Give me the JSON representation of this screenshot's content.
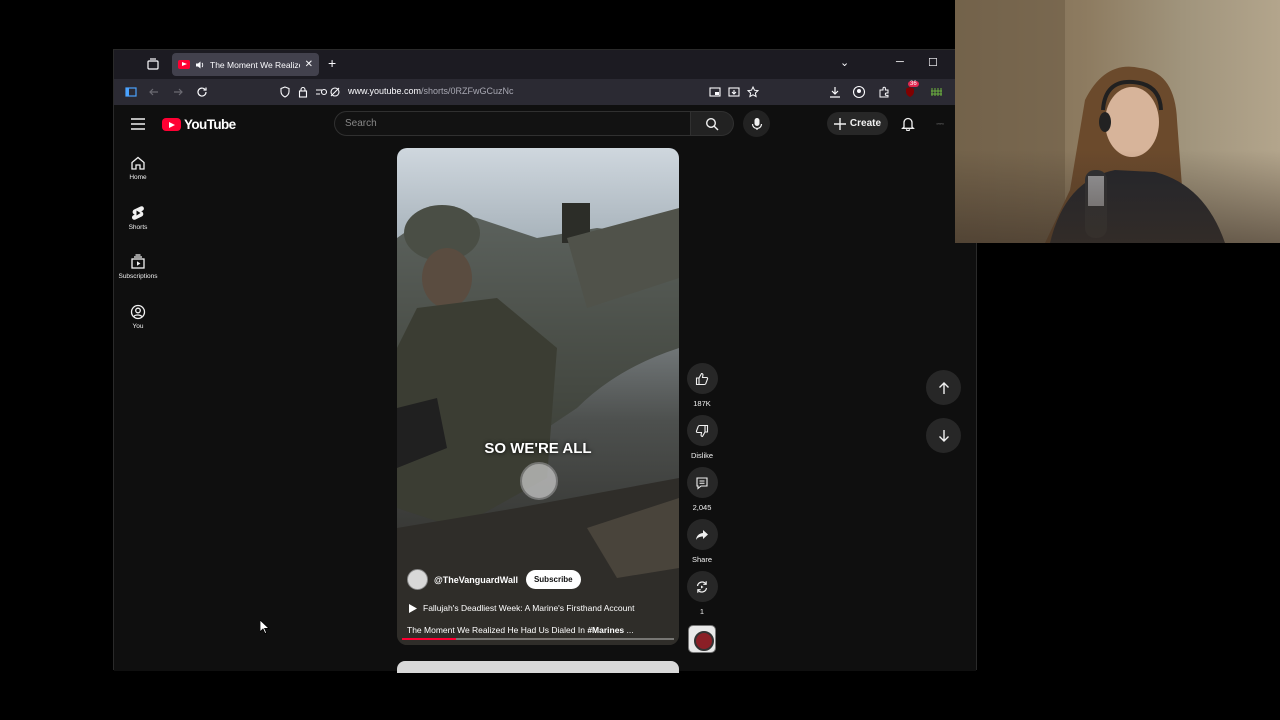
{
  "browser": {
    "tab_title": "The Moment We Realized H",
    "url_host": "www.youtube.com",
    "url_path": "/shorts/0RZFwGCuzNc",
    "extension_badge": "36"
  },
  "header": {
    "logo_text": "YouTube",
    "search_placeholder": "Search",
    "create_label": "Create"
  },
  "sidebar": {
    "items": [
      {
        "label": "Home",
        "icon": "home-icon"
      },
      {
        "label": "Shorts",
        "icon": "shorts-icon"
      },
      {
        "label": "Subscriptions",
        "icon": "subscriptions-icon"
      },
      {
        "label": "You",
        "icon": "you-icon"
      }
    ]
  },
  "video": {
    "caption": "SO WE'RE ALL",
    "channel": "@TheVanguardWall",
    "subscribe_label": "Subscribe",
    "playlist_title": "Fallujah's Deadliest Week: A Marine's Firsthand Account",
    "description": "The Moment We Realized He Had Us Dialed In ",
    "hashtag": "#Marines",
    "ellipsis": " ...",
    "progress": 0.2
  },
  "actions": {
    "likes": "187K",
    "dislike_label": "Dislike",
    "comments": "2,045",
    "share_label": "Share",
    "remix_count": "1"
  },
  "colors": {
    "accent": "#ff0033",
    "background": "#0f0f0f",
    "button": "#272727"
  }
}
